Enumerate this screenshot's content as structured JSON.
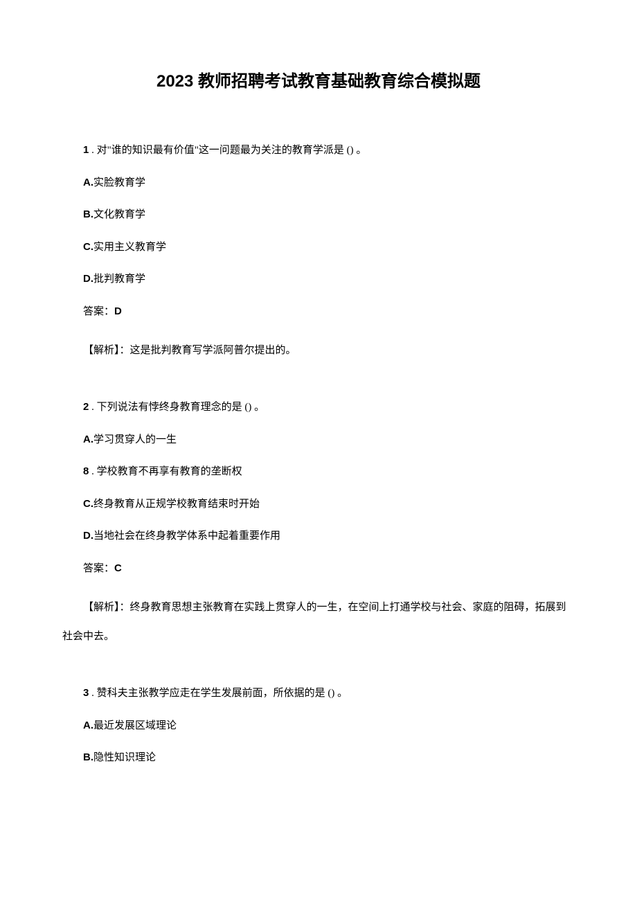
{
  "title": "2023 教师招聘考试教育基础教育综合模拟题",
  "q1": {
    "num": "1",
    "stem": " . 对\"谁的知识最有价值\"这一问题最为关注的教育学派是 () 。",
    "a_letter": "A.",
    "a_text": "实脸教育学",
    "b_letter": "B.",
    "b_text": "文化教育学",
    "c_letter": "C.",
    "c_text": "实用主义教育学",
    "d_letter": "D.",
    "d_text": "批判教育学",
    "answer_label": "答案：",
    "answer_letter": "D",
    "explain": "【解析】：这是批判教育写学派阿普尔提出的。"
  },
  "q2": {
    "num": "2",
    "stem": " . 下列说法有悖终身教育理念的是 () 。",
    "a_letter": "A.",
    "a_text": "学习贯穿人的一生",
    "b_num": "8",
    "b_stem": " . 学校教育不再享有教育的垄断权",
    "c_letter": "C.",
    "c_text": "终身教育从正规学校教育结束时开始",
    "d_letter": "D.",
    "d_text": "当地社会在终身教学体系中起着重要作用",
    "answer_label": "答案：",
    "answer_letter": "C",
    "explain": "【解析】：终身教育思想主张教育在实践上贯穿人的一生，在空间上打通学校与社会、家庭的阻碍，拓展到社会中去。"
  },
  "q3": {
    "num": "3",
    "stem": " . 赞科夫主张教学应走在学生发展前面，所依据的是 () 。",
    "a_letter": "A.",
    "a_text": "最近发展区域理论",
    "b_letter": "B.",
    "b_text": "隐性知识理论"
  }
}
